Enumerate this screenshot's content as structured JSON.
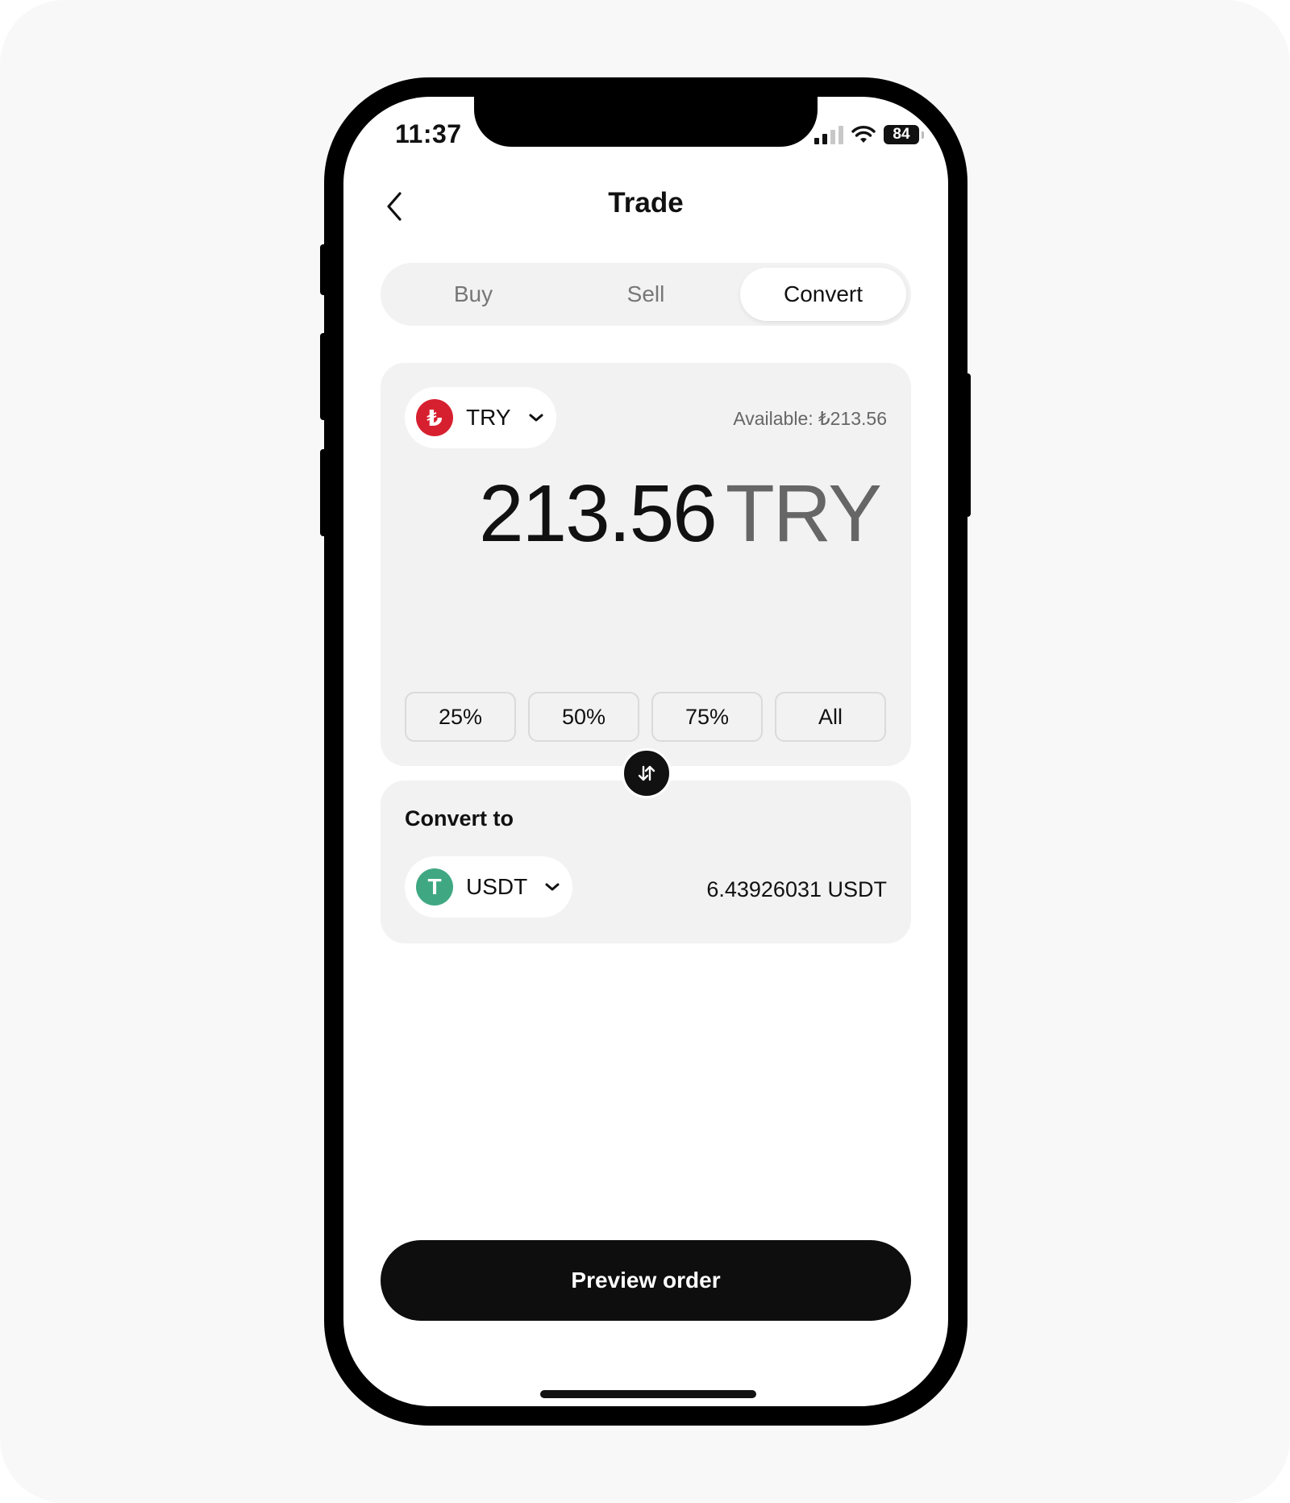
{
  "status_bar": {
    "time": "11:37",
    "battery": "84",
    "icons": [
      "signal-icon",
      "wifi-icon",
      "battery-icon"
    ]
  },
  "header": {
    "title": "Trade",
    "back_icon": "chevron-left-icon"
  },
  "tabs": [
    {
      "label": "Buy",
      "selected": false
    },
    {
      "label": "Sell",
      "selected": false
    },
    {
      "label": "Convert",
      "selected": true
    }
  ],
  "from": {
    "asset": "TRY",
    "asset_symbol": "₺",
    "available": "Available: ₺213.56",
    "amount": "213.56",
    "unit": "TRY",
    "percent_buttons": [
      "25%",
      "50%",
      "75%",
      "All"
    ]
  },
  "to": {
    "label": "Convert to",
    "asset": "USDT",
    "asset_symbol": "T",
    "amount": "6.43926031 USDT"
  },
  "actions": {
    "preview_label": "Preview order"
  },
  "colors": {
    "accent": "#0e0e0e",
    "try_brand": "#d7202f",
    "usdt_brand": "#3fa883",
    "card_bg": "#f2f2f2",
    "page_bg": "#f8f8f8"
  }
}
